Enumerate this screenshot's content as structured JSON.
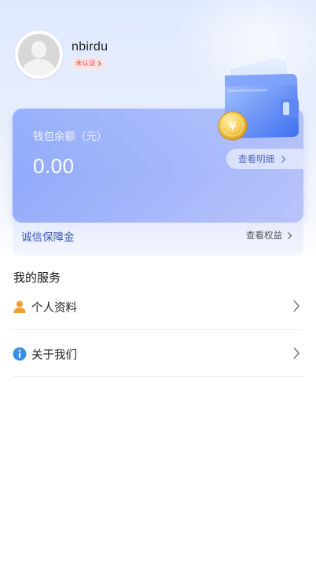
{
  "profile": {
    "username": "nbirdu",
    "verify_status": "未认证"
  },
  "wallet": {
    "balance_label": "钱包余额（元）",
    "balance_value": "0.00",
    "detail_button": "查看明细",
    "currency_icon": "yuan-coin-icon"
  },
  "deposit": {
    "label": "诚信保障金",
    "link": "查看权益"
  },
  "services": {
    "title": "我的服务",
    "items": [
      {
        "label": "个人资料",
        "icon": "person-icon"
      },
      {
        "label": "关于我们",
        "icon": "info-icon"
      }
    ]
  },
  "colors": {
    "accent_blue": "#3a58b8",
    "card_gradient_start": "#8aa6fb",
    "card_gradient_end": "#b9c4fa",
    "badge_red": "#e24b4b",
    "person_icon_orange": "#f0a030",
    "info_icon_blue": "#3a8ee6"
  }
}
